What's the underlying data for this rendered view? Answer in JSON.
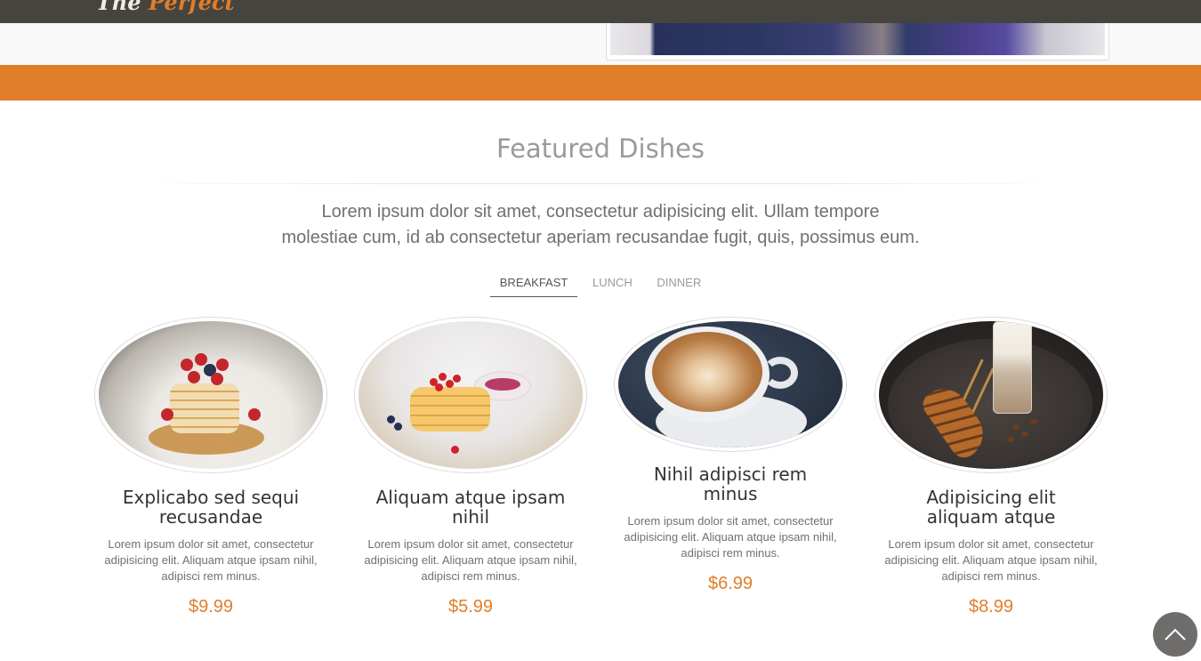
{
  "nav": {
    "logo_part1": "The ",
    "logo_part2": "Perfect"
  },
  "colors": {
    "accent": "#e07e2a",
    "nav_bg": "#46443f",
    "title": "#9a9a9a"
  },
  "section": {
    "title": "Featured Dishes",
    "description_line1": "Lorem ipsum dolor sit amet, consectetur adipisicing elit. Ullam tempore",
    "description_line2": "molestiae cum, id ab consectetur aperiam recusandae fugit, quis, possimus eum."
  },
  "tabs": [
    {
      "label": "BREAKFAST",
      "active": true
    },
    {
      "label": "LUNCH",
      "active": false
    },
    {
      "label": "DINNER",
      "active": false
    }
  ],
  "dishes": [
    {
      "name": "Explicabo sed sequi recusandae",
      "description": "Lorem ipsum dolor sit amet, consectetur adipisicing elit. Aliquam atque ipsam nihil, adipisci rem minus.",
      "price": "$9.99",
      "image": "pancakes-strawberries"
    },
    {
      "name": "Aliquam atque ipsam nihil",
      "description": "Lorem ipsum dolor sit amet, consectetur adipisicing elit. Aliquam atque ipsam nihil, adipisci rem minus.",
      "price": "$5.99",
      "image": "pancakes-berries"
    },
    {
      "name": "Nihil adipisci rem minus",
      "description": "Lorem ipsum dolor sit amet, consectetur adipisicing elit. Aliquam atque ipsam nihil, adipisci rem minus.",
      "price": "$6.99",
      "image": "latte"
    },
    {
      "name": "Adipisicing elit aliquam atque",
      "description": "Lorem ipsum dolor sit amet, consectetur adipisicing elit. Aliquam atque ipsam nihil, adipisci rem minus.",
      "price": "$8.99",
      "image": "croissant-coffee"
    }
  ],
  "scroll_top": {
    "icon": "chevron-up-icon"
  }
}
